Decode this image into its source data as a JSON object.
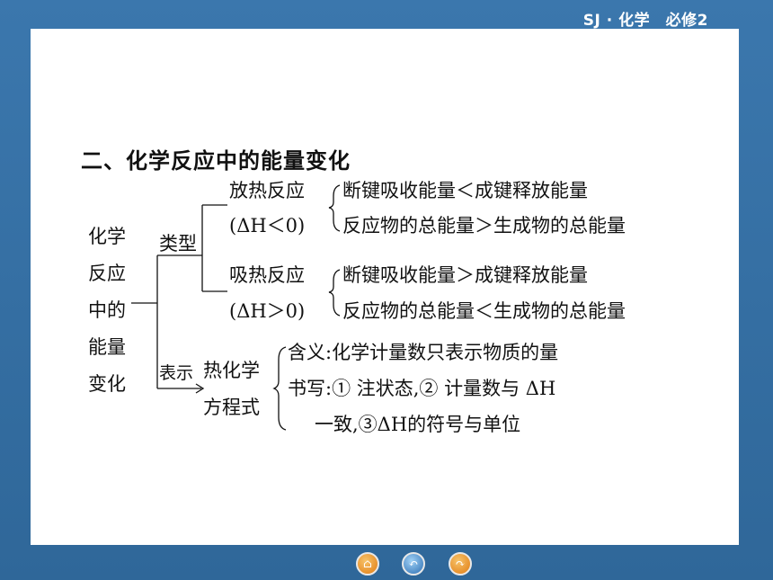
{
  "header": {
    "tag": "SJ · 化学　必修2"
  },
  "slide": {
    "title": "二、化学反应中的能量变化",
    "root": [
      "化学",
      "反应",
      "中的",
      "能量",
      "变化"
    ],
    "type_label": "类型",
    "exo": {
      "name": "放热反应",
      "condition": "(ΔH＜0)",
      "line1": "断键吸收能量＜成键释放能量",
      "line2": "反应物的总能量＞生成物的总能量"
    },
    "endo": {
      "name": "吸热反应",
      "condition": "(ΔH＞0)",
      "line1": "断键吸收能量＞成键释放能量",
      "line2": "反应物的总能量＜生成物的总能量"
    },
    "express_label": "表示",
    "equation_label_1": "热化学",
    "equation_label_2": "方程式",
    "meaning": "含义:化学计量数只表示物质的量",
    "writing_1": "书写:① 注状态,② 计量数与 ΔH",
    "writing_2": "一致,③ΔH的符号与单位"
  },
  "nav": {
    "home": "⌂",
    "back": "↶",
    "forward": "↷"
  }
}
